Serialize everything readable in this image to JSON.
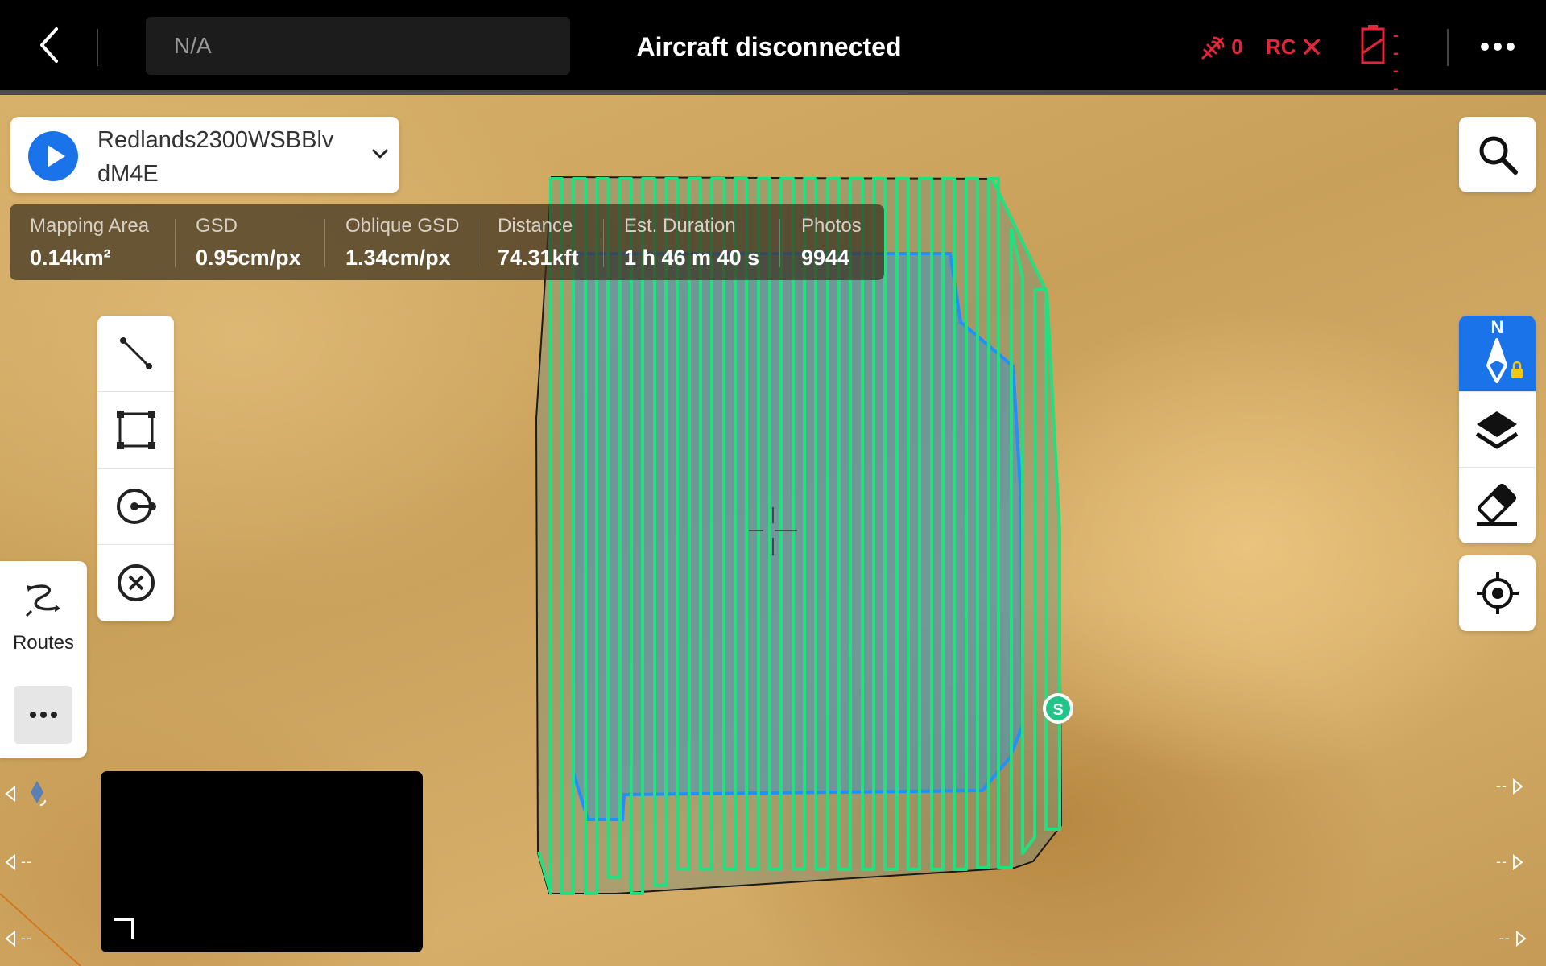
{
  "topbar": {
    "search_value": "N/A",
    "status_title": "Aircraft disconnected",
    "satellite_count": "0",
    "rc_label": "RC",
    "battery_level": "--",
    "battery_level2": "--"
  },
  "route": {
    "name": "Redlands2300WSBBlv dM4E"
  },
  "stats": [
    {
      "label": "Mapping Area",
      "value": "0.14km²"
    },
    {
      "label": "GSD",
      "value": "0.95cm/px"
    },
    {
      "label": "Oblique GSD",
      "value": "1.34cm/px"
    },
    {
      "label": "Distance",
      "value": "74.31kft"
    },
    {
      "label": "Est. Duration",
      "value": "1 h 46 m 40 s"
    },
    {
      "label": "Photos",
      "value": "9944"
    }
  ],
  "tools": [
    {
      "icon": "line-tool-icon"
    },
    {
      "icon": "area-tool-icon"
    },
    {
      "icon": "point-tool-icon"
    },
    {
      "icon": "clear-icon"
    }
  ],
  "routes_panel": {
    "label": "Routes"
  },
  "right_tools": {
    "compass_label": "N"
  },
  "map": {
    "start_label": "S",
    "edge_left_1": "--",
    "edge_left_2": "--",
    "edge_right_1": "--",
    "edge_right_2": "--",
    "edge_right_3": "--"
  },
  "colors": {
    "accent": "#1a73e8",
    "flight_path": "#22e07f",
    "mapping_area": "#1e90ff",
    "alert": "#e5263a"
  }
}
